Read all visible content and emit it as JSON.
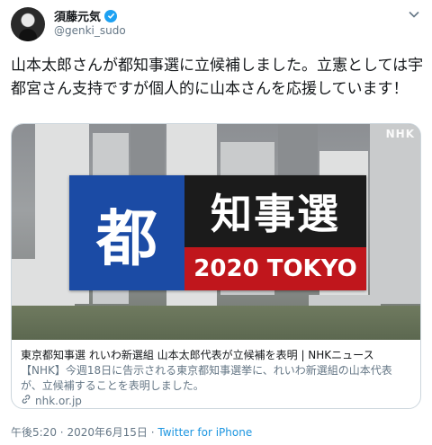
{
  "author": {
    "display_name": "須藤元気",
    "handle": "@genki_sudo"
  },
  "tweet": {
    "text": "山本太郎さんが都知事選に立候補しました。立憲としては宇都宮さん支持ですが個人的に山本さんを応援しています！"
  },
  "card": {
    "image_watermark": "NHK",
    "banner_kanji_left": "都",
    "banner_kanji_right": "知事選",
    "banner_subtitle": "2020 TOKYO",
    "title": "東京都知事選 れいわ新選組 山本太郎代表が立候補を表明 | NHKニュース",
    "description": "【NHK】今週18日に告示される東京都知事選挙に、れいわ新選組の山本代表が、立候補することを表明しました。",
    "domain": "nhk.or.jp"
  },
  "meta": {
    "time": "午後5:20",
    "separator": "·",
    "date": "2020年6月15日",
    "source": "Twitter for iPhone"
  },
  "colors": {
    "accent": "#1da1f2",
    "banner_blue": "#1b4ba5",
    "banner_red": "#c0161c"
  },
  "icons": [
    "verified-badge-icon",
    "chevron-down-icon",
    "link-icon"
  ]
}
